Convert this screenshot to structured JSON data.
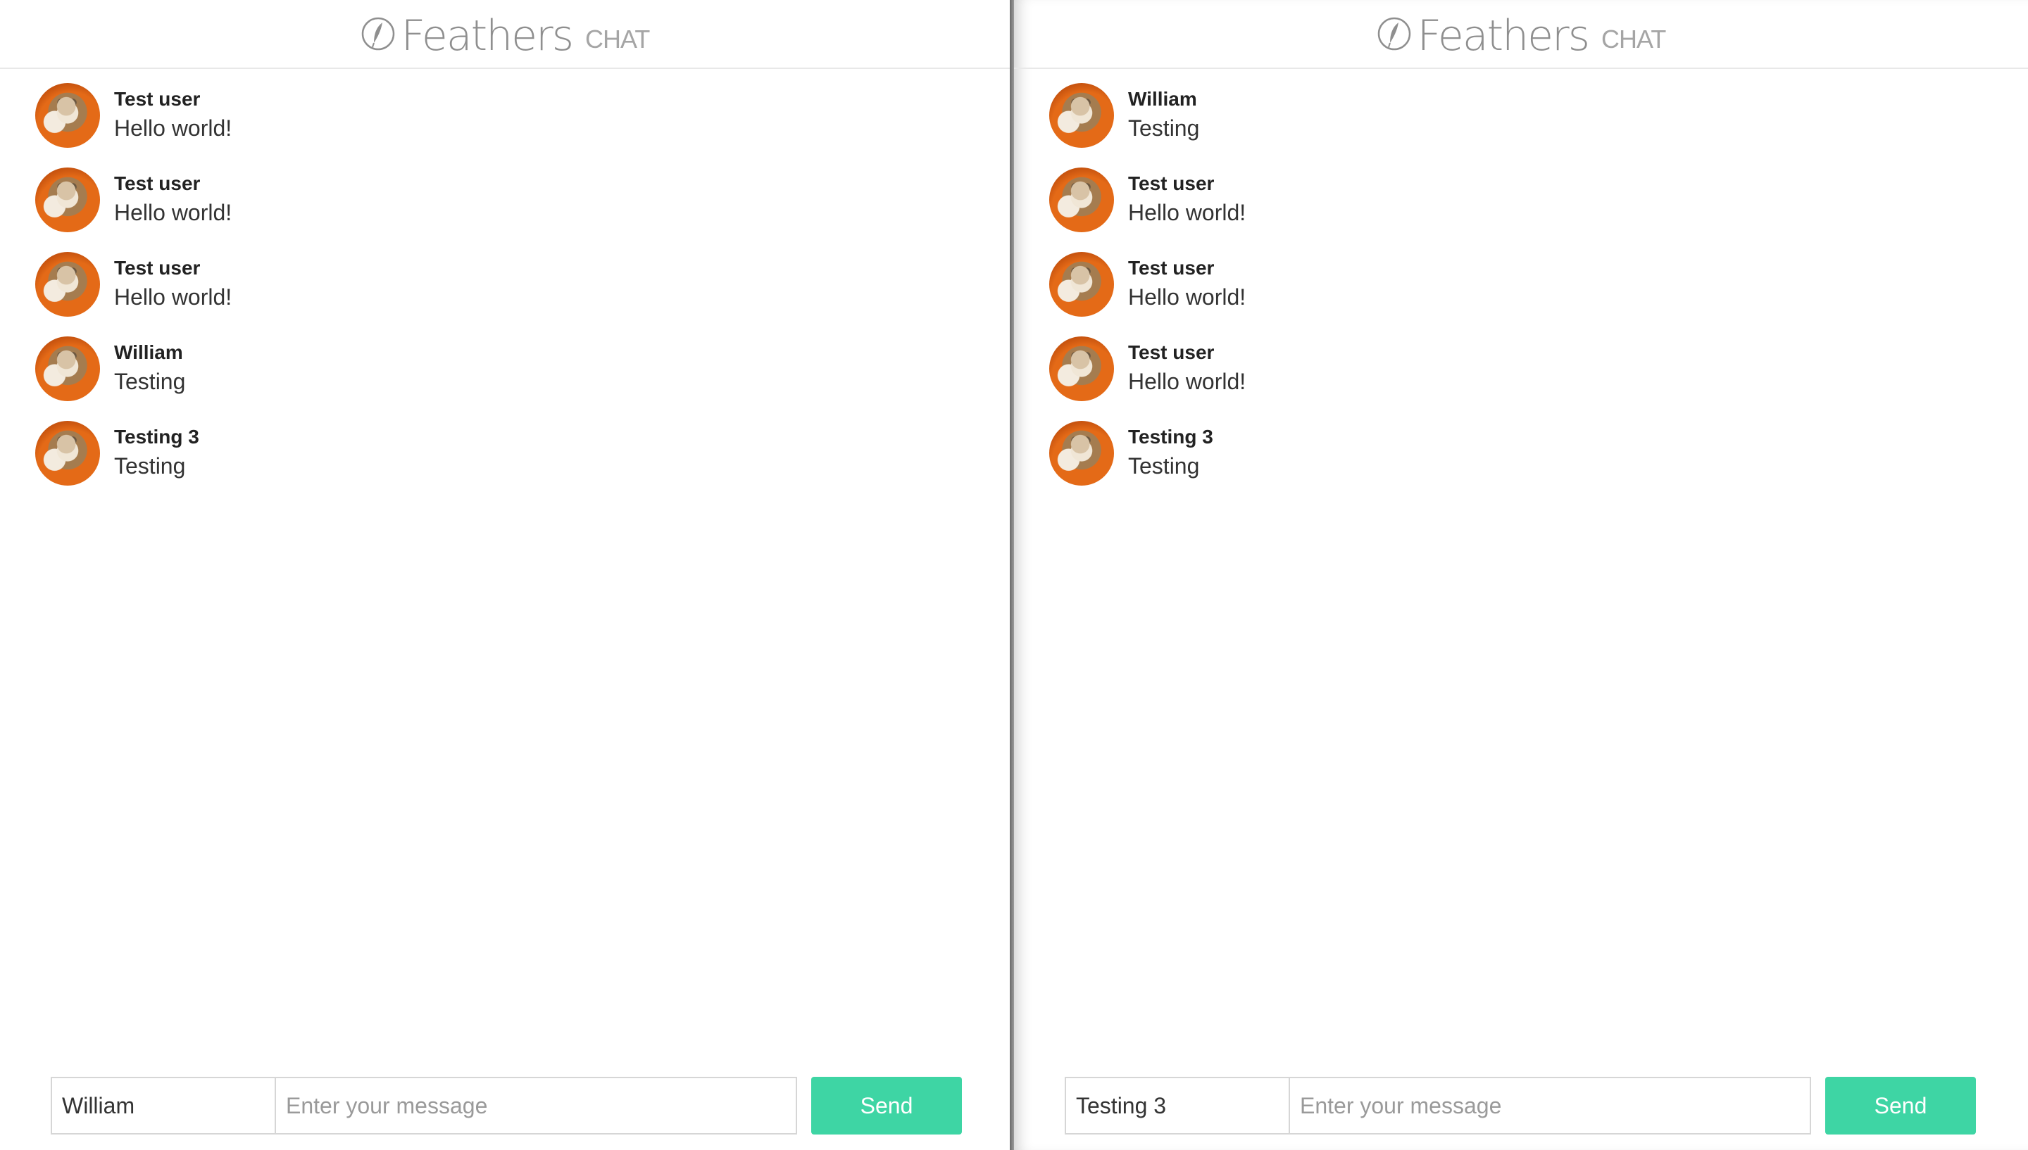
{
  "colors": {
    "accent": "#3ed5a4",
    "logo": "#8f8f8f",
    "text": "#333333",
    "background": "#ffffff"
  },
  "windows": [
    {
      "header": {
        "title": "Feathers",
        "subtitle": "CHAT",
        "icon": "feather-icon"
      },
      "messages": [
        {
          "author": "Test user",
          "text": "Hello world!"
        },
        {
          "author": "Test user",
          "text": "Hello world!"
        },
        {
          "author": "Test user",
          "text": "Hello world!"
        },
        {
          "author": "William",
          "text": "Testing"
        },
        {
          "author": "Testing 3",
          "text": "Testing"
        }
      ],
      "composer": {
        "name_value": "William",
        "message_placeholder": "Enter your message",
        "send_label": "Send"
      }
    },
    {
      "header": {
        "title": "Feathers",
        "subtitle": "CHAT",
        "icon": "feather-icon"
      },
      "messages": [
        {
          "author": "William",
          "text": "Testing"
        },
        {
          "author": "Test user",
          "text": "Hello world!"
        },
        {
          "author": "Test user",
          "text": "Hello world!"
        },
        {
          "author": "Test user",
          "text": "Hello world!"
        },
        {
          "author": "Testing 3",
          "text": "Testing"
        }
      ],
      "composer": {
        "name_value": "Testing 3",
        "message_placeholder": "Enter your message",
        "send_label": "Send"
      }
    }
  ]
}
